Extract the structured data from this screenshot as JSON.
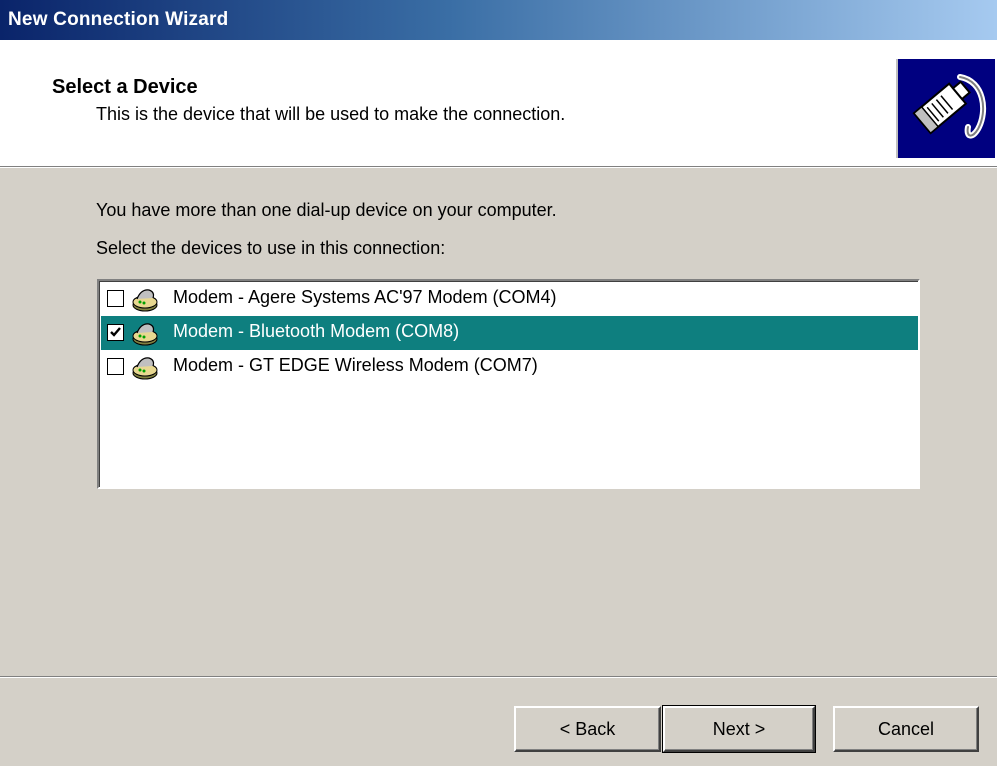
{
  "window": {
    "title": "New Connection Wizard"
  },
  "header": {
    "heading": "Select a Device",
    "subheading": "This is the device that will be used to make the connection.",
    "icon": "network-cable-icon"
  },
  "body": {
    "intro": "You have more than one dial-up device on your computer.",
    "prompt": "Select the devices to use in this connection:"
  },
  "devices": [
    {
      "label": "Modem - Agere Systems AC'97 Modem (COM4)",
      "checked": false,
      "selected": false,
      "icon": "modem-icon"
    },
    {
      "label": "Modem - Bluetooth Modem (COM8)",
      "checked": true,
      "selected": true,
      "icon": "modem-icon"
    },
    {
      "label": "Modem - GT EDGE Wireless Modem (COM7)",
      "checked": false,
      "selected": false,
      "icon": "modem-icon"
    }
  ],
  "buttons": {
    "back": "< Back",
    "next": "Next >",
    "cancel": "Cancel"
  },
  "colors": {
    "selection": "#0e7f7f",
    "titlebar_start": "#0a246a",
    "titlebar_end": "#a6caf0",
    "icon_bg": "#000080",
    "face": "#d4d0c8"
  }
}
